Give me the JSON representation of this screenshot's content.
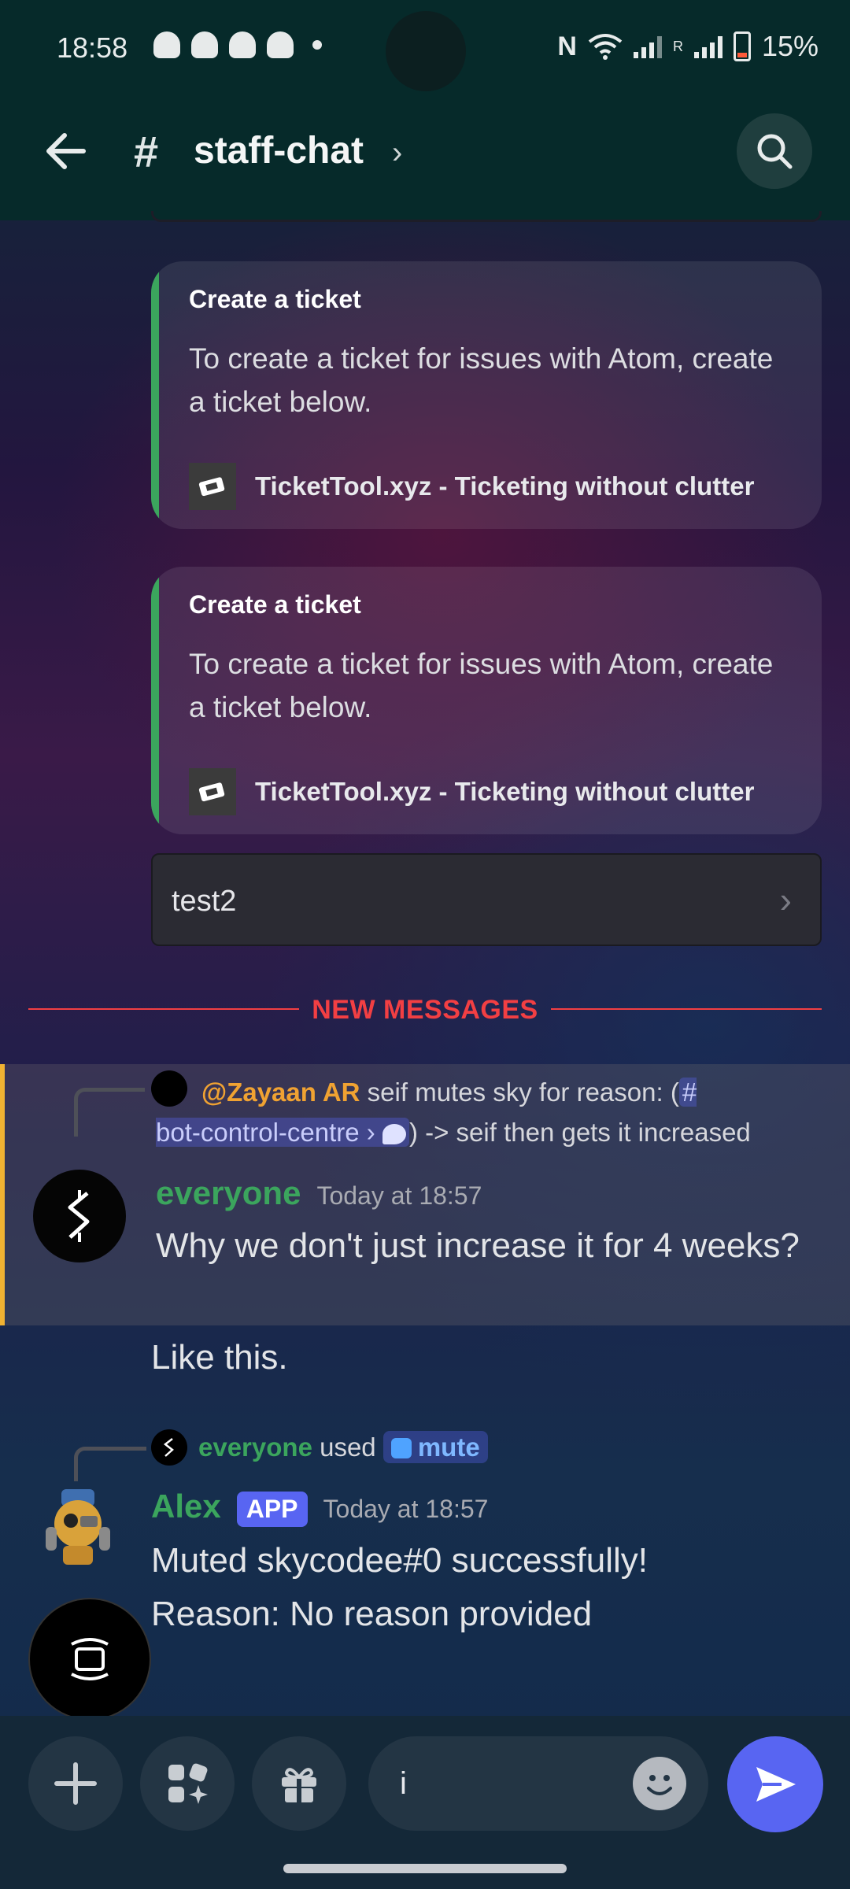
{
  "status_bar": {
    "time": "18:58",
    "nfc": "N",
    "roaming": "R",
    "battery": "15%"
  },
  "header": {
    "channel_hash": "#",
    "channel_name": "staff-chat",
    "chevron": "›"
  },
  "embeds": [
    {
      "title": "Create a ticket",
      "description": "To create a ticket for issues with Atom, create a ticket below.",
      "link_text": "TicketTool.xyz - Ticketing without clutter",
      "accent_color": "#3ba55d"
    },
    {
      "title": "Create a ticket",
      "description": "To create a ticket for issues with Atom, create a ticket below.",
      "link_text": "TicketTool.xyz - Ticketing without clutter",
      "accent_color": "#3ba55d"
    }
  ],
  "select_menu": {
    "value": "test2",
    "chevron": "›"
  },
  "new_messages_label": "NEW MESSAGES",
  "message1": {
    "reply": {
      "mention": "@Zayaan AR",
      "text_before": " seif mutes sky for reason: (",
      "channel_hash": "#",
      "channel": "bot-control-centre",
      "channel_chevron": "›",
      "text_after": ") -> seif then gets it increased"
    },
    "author": "everyone",
    "timestamp": "Today at 18:57",
    "text": "Why we don't just increase it for 4 weeks?",
    "followup": "Like this."
  },
  "message2": {
    "command": {
      "user": "everyone",
      "used": " used ",
      "command_name": "mute"
    },
    "author": "Alex",
    "badge": "APP",
    "timestamp": "Today at 18:57",
    "line1": "Muted skycodee#0 successfully!",
    "line2": "Reason: No reason provided"
  },
  "composer": {
    "input_value": "i"
  },
  "colors": {
    "accent": "#5865f2",
    "new_messages": "#f23f43",
    "author_green": "#3ba55d",
    "highlight_bar": "#f0b232"
  }
}
